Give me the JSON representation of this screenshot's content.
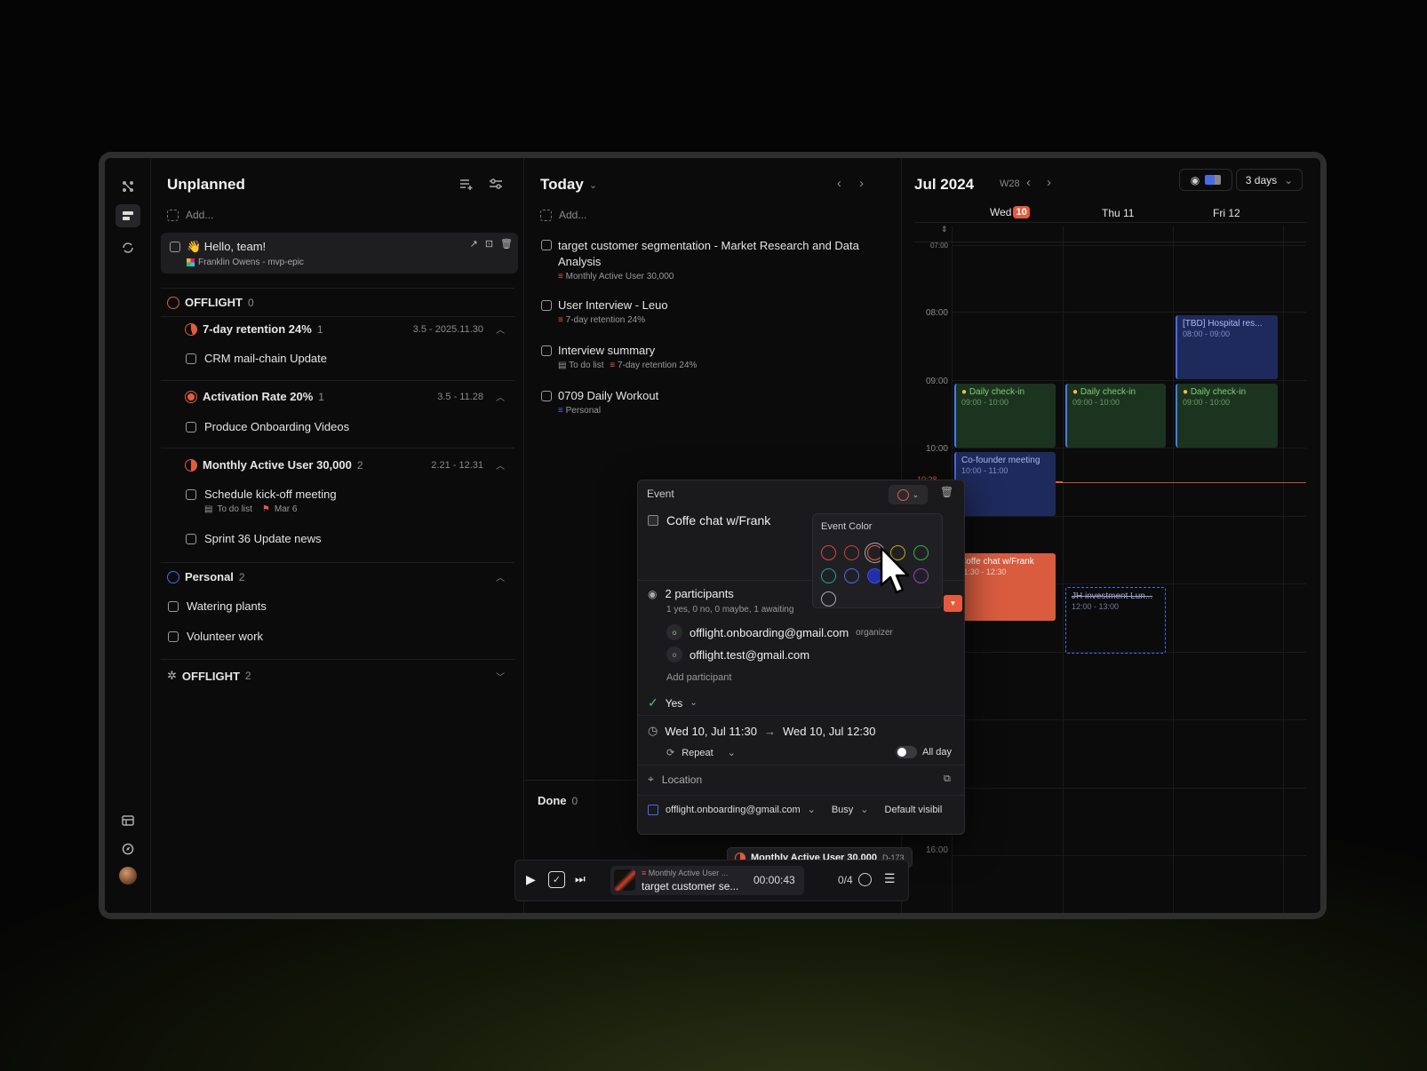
{
  "colors": {
    "accent_orange": "#e55a3c",
    "green_event": "#1c3320",
    "blue_event": "#1e2a5c",
    "today_badge": "#e55a3c"
  },
  "rail": {
    "icons": [
      "apps-icon",
      "board-icon",
      "sync-icon",
      "calendar-table-icon",
      "explore-icon",
      "avatar"
    ]
  },
  "unplanned": {
    "title": "Unplanned",
    "add_placeholder": "Add...",
    "hello_card": {
      "title": "👋 Hello, team!",
      "sub": "Franklin Owens - mvp-epic"
    },
    "group1": {
      "name": "OFFLIGHT",
      "count": "0",
      "goals": [
        {
          "name": "7-day retention 24%",
          "count": "1",
          "dates": "3.5 - 2025.11.30",
          "tasks": [
            {
              "title": "CRM mail-chain Update"
            }
          ]
        },
        {
          "name": "Activation Rate 20%",
          "count": "1",
          "dates": "3.5 - 11.28",
          "tasks": [
            {
              "title": "Produce Onboarding Videos"
            }
          ]
        },
        {
          "name": "Monthly Active User 30,000",
          "count": "2",
          "dates": "2.21 - 12.31",
          "tasks": [
            {
              "title": "Schedule kick-off meeting",
              "tag1": "To do list",
              "tag2": "Mar 6"
            },
            {
              "title": "Sprint 36 Update news"
            }
          ]
        }
      ]
    },
    "personal": {
      "name": "Personal",
      "count": "2",
      "tasks": [
        "Watering plants",
        "Volunteer work"
      ]
    },
    "group2": {
      "name": "OFFLIGHT",
      "count": "2"
    }
  },
  "today": {
    "title": "Today",
    "add_placeholder": "Add...",
    "tasks": [
      {
        "title": "target customer segmentation - Market Research and Data",
        "title2": "Analysis",
        "meta": "Monthly Active User 30,000"
      },
      {
        "title": "User Interview - Leuo",
        "meta": "7-day retention 24%"
      },
      {
        "title": "Interview summary",
        "meta1": "To do list",
        "meta2": "7-day retention 24%"
      },
      {
        "title": "0709 Daily Workout",
        "meta": "Personal"
      }
    ],
    "done_label": "Done",
    "done_count": "0"
  },
  "calendar": {
    "month": "Jul 2024",
    "week": "W28",
    "view": "3 days",
    "days": [
      {
        "name": "Wed",
        "badge": "10"
      },
      {
        "name": "Thu 11"
      },
      {
        "name": "Fri 12"
      }
    ],
    "hours": [
      "07:00",
      "08:00",
      "09:00",
      "10:00",
      "16:00"
    ],
    "now_label": "10:28",
    "events": {
      "hospital": {
        "title": "[TBD] Hospital res...",
        "time": "08:00 - 09:00"
      },
      "checkin": {
        "title": "Daily check-in",
        "time": "09:00 - 10:00"
      },
      "cofounder": {
        "title": "Co-founder meeting",
        "time": "10:00 - 11:00"
      },
      "coffee": {
        "title": "Coffe chat w/Frank",
        "time": "11:30 - 12:30"
      },
      "investment": {
        "title": "JH investment Lun...",
        "time": "12:00 - 13:00"
      }
    }
  },
  "event_popup": {
    "header": "Event",
    "title": "Coffe chat w/Frank",
    "participants": "2 participants",
    "rsvp_summary": "1 yes, 0 no, 0 maybe, 1 awaiting",
    "p1": "offlight.onboarding@gmail.com",
    "p1_role": "organizer",
    "p2": "offlight.test@gmail.com",
    "add_participant": "Add participant",
    "response": "Yes",
    "start": "Wed 10, Jul  11:30",
    "end": "Wed 10, Jul  12:30",
    "repeat": "Repeat",
    "all_day": "All day",
    "location": "Location",
    "calendar": "offlight.onboarding@gmail.com",
    "busy": "Busy",
    "visibility": "Default visibil",
    "color_title": "Event Color"
  },
  "goal_chip": {
    "label": "Monthly Active User 30,000",
    "id": "D-173"
  },
  "player": {
    "goal": "Monthly Active User ...",
    "task": "target customer se...",
    "timer": "00:00:43",
    "progress": "0/4"
  }
}
